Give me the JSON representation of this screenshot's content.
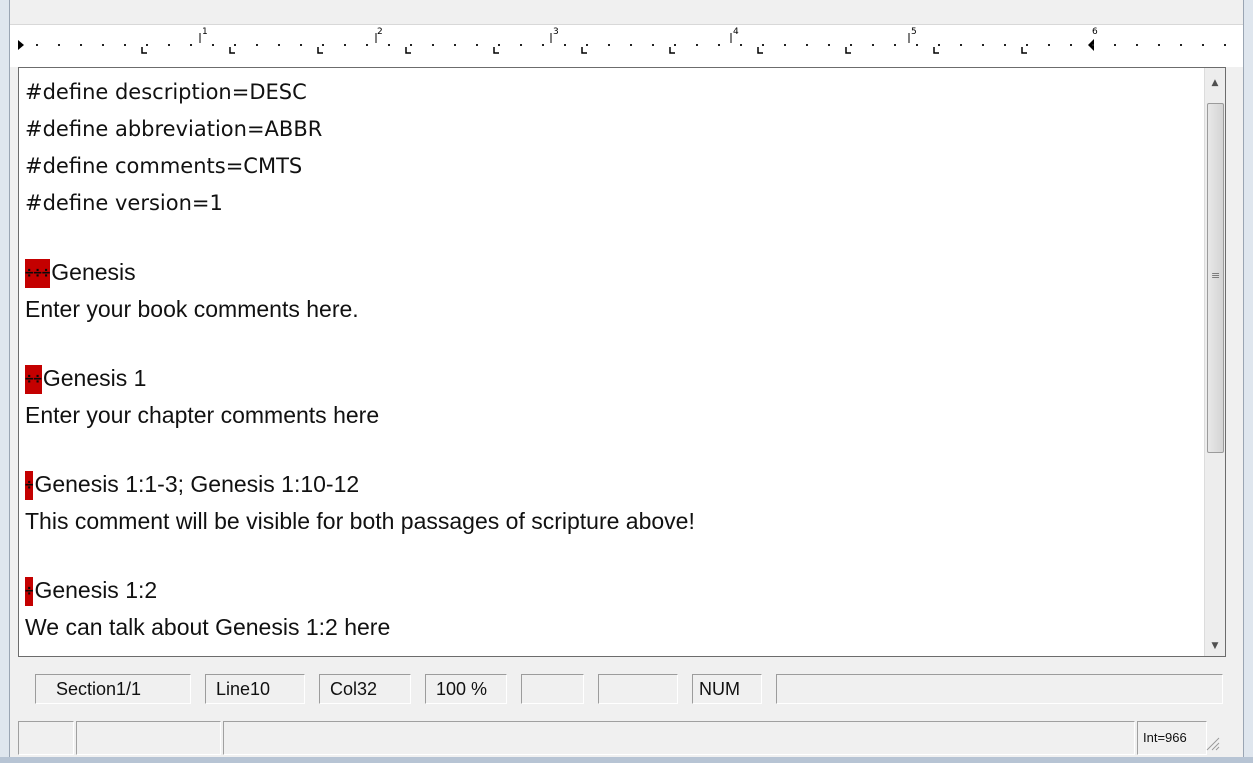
{
  "ruler": {
    "labels": [
      "1",
      "2",
      "3",
      "4",
      "5",
      "6"
    ]
  },
  "editor": {
    "lines": [
      {
        "kind": "code",
        "text": "#define description=DESC"
      },
      {
        "kind": "code",
        "text": "#define abbreviation=ABBR"
      },
      {
        "kind": "code",
        "text": "#define comments=CMTS"
      },
      {
        "kind": "code",
        "text": "#define version=1"
      },
      {
        "kind": "spacer",
        "text": ""
      },
      {
        "kind": "heading",
        "marker": "÷÷÷",
        "text": "Genesis"
      },
      {
        "kind": "text",
        "text": "Enter your book comments here."
      },
      {
        "kind": "spacer",
        "text": ""
      },
      {
        "kind": "heading",
        "marker": "÷÷",
        "text": "Genesis 1"
      },
      {
        "kind": "text",
        "text": "Enter your chapter comments here"
      },
      {
        "kind": "spacer",
        "text": ""
      },
      {
        "kind": "heading",
        "marker": "÷",
        "text": "Genesis 1:1-3; Genesis 1:10-12"
      },
      {
        "kind": "text",
        "text": "This comment will be visible for both passages of scripture above!"
      },
      {
        "kind": "spacer",
        "text": ""
      },
      {
        "kind": "heading",
        "marker": "÷",
        "text": "Genesis 1:2"
      },
      {
        "kind": "text",
        "text": "We can talk about Genesis 1:2 here"
      }
    ],
    "marker_color": "#c40000"
  },
  "statusbar": {
    "section": "Section1/1",
    "line": "Line10",
    "col": "Col32",
    "zoom": "100 %",
    "num": "NUM"
  },
  "bottombar": {
    "int": "Int=966"
  }
}
